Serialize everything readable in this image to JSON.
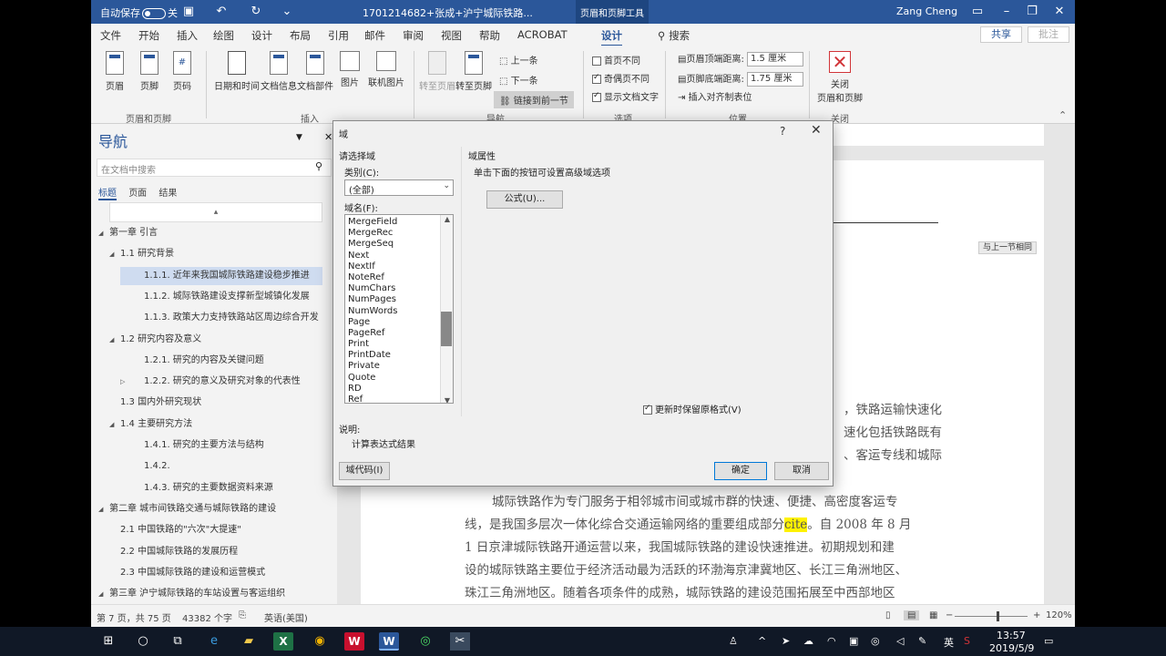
{
  "titlebar": {
    "autosave_label": "自动保存",
    "autosave_state": "关",
    "doc_title": "1701214682+张成+沪宁城际铁路...",
    "context_tab": "页眉和页脚工具",
    "user": "Zang Cheng"
  },
  "menu": {
    "items": [
      "文件",
      "开始",
      "插入",
      "绘图",
      "设计",
      "布局",
      "引用",
      "邮件",
      "审阅",
      "视图",
      "帮助",
      "ACROBAT",
      "设计"
    ],
    "search": "搜索",
    "share": "共享",
    "comment": "批注"
  },
  "ribbon": {
    "header_footer": [
      "页眉",
      "页脚",
      "页码"
    ],
    "insert": [
      "日期和时间",
      "文档信息",
      "文档部件",
      "图片",
      "联机图片"
    ],
    "navigate": [
      "转至页眉",
      "转至页脚"
    ],
    "nav_small": [
      "上一条",
      "下一条",
      "链接到前一节"
    ],
    "options": [
      "首页不同",
      "奇偶页不同",
      "显示文档文字"
    ],
    "position": {
      "header_top_label": "页眉顶端距离:",
      "header_top_value": "1.5 厘米",
      "footer_bottom_label": "页脚底端距离:",
      "footer_bottom_value": "1.75 厘米",
      "align_tab": "插入对齐制表位"
    },
    "close": "关闭\n页眉和页脚",
    "close_l1": "关闭",
    "close_l2": "页眉和页脚",
    "groups": [
      "页眉和页脚",
      "插入",
      "导航",
      "选项",
      "位置",
      "关闭"
    ]
  },
  "nav": {
    "title": "导航",
    "search_placeholder": "在文档中搜索",
    "tabs": [
      "标题",
      "页面",
      "结果"
    ],
    "items": [
      {
        "text": "第一章  引言",
        "level": 0,
        "arrow": "◢"
      },
      {
        "text": "1.1 研究背景",
        "level": 1,
        "arrow": "◢"
      },
      {
        "text": "1.1.1. 近年来我国城际铁路建设稳步推进",
        "level": 2,
        "arrow": "",
        "selected": true
      },
      {
        "text": "1.1.2. 城际铁路建设支撑新型城镇化发展",
        "level": 2,
        "arrow": ""
      },
      {
        "text": "1.1.3. 政策大力支持铁路站区周边综合开发",
        "level": 2,
        "arrow": ""
      },
      {
        "text": "1.2 研究内容及意义",
        "level": 1,
        "arrow": "◢"
      },
      {
        "text": "1.2.1. 研究的内容及关键问题",
        "level": 2,
        "arrow": ""
      },
      {
        "text": "1.2.2. 研究的意义及研究对象的代表性",
        "level": 2,
        "arrow": "▷"
      },
      {
        "text": "1.3 国内外研究现状",
        "level": 1,
        "arrow": ""
      },
      {
        "text": "1.4 主要研究方法",
        "level": 1,
        "arrow": "◢"
      },
      {
        "text": "1.4.1. 研究的主要方法与结构",
        "level": 2,
        "arrow": ""
      },
      {
        "text": "1.4.2.",
        "level": 2,
        "arrow": ""
      },
      {
        "text": "1.4.3. 研究的主要数据资料来源",
        "level": 2,
        "arrow": ""
      },
      {
        "text": "第二章  城市间铁路交通与城际铁路的建设",
        "level": 0,
        "arrow": "◢"
      },
      {
        "text": "2.1 中国铁路的\"六次\"大提速\"",
        "level": 1,
        "arrow": ""
      },
      {
        "text": "2.2 中国城际铁路的发展历程",
        "level": 1,
        "arrow": ""
      },
      {
        "text": "2.3 中国城际铁路的建设和运营模式",
        "level": 1,
        "arrow": ""
      },
      {
        "text": "第三章  沪宁城际铁路的车站设置与客运组织",
        "level": 0,
        "arrow": "◢"
      }
    ]
  },
  "document": {
    "header_tag": "与上一节相同",
    "right_lines": [
      "，铁路运输快速化",
      "速化包括铁路既有",
      "、客运专线和城际"
    ],
    "para_lines": [
      "城际铁路作为专门服务于相邻城市间或城市群的快速、便捷、高密度客运专",
      "线，是我国多层次一体化综合交通运输网络的重要组成部分",
      "cite",
      "。自 2008 年 8 月",
      "1 日京津城际铁路开通运营以来，我国城际铁路的建设快速推进。初期规划和建",
      "设的城际铁路主要位于经济活动最为活跃的环渤海京津冀地区、长江三角洲地区、",
      "珠江三角洲地区。随着各项条件的成熟，城际铁路的建设范围拓展至中西部地区"
    ]
  },
  "dialog": {
    "title": "域",
    "help": "?",
    "choose_label": "请选择域",
    "category_label": "类别(C):",
    "category_value": "(全部)",
    "fieldname_label": "域名(F):",
    "fields": [
      "MergeField",
      "MergeRec",
      "MergeSeq",
      "Next",
      "NextIf",
      "NoteRef",
      "NumChars",
      "NumPages",
      "NumWords",
      "Page",
      "PageRef",
      "Print",
      "PrintDate",
      "Private",
      "Quote",
      "RD",
      "Ref"
    ],
    "properties_label": "域属性",
    "properties_hint": "单击下面的按钮可设置高级域选项",
    "formula_button": "公式(U)...",
    "preserve_format": "更新时保留原格式(V)",
    "description_label": "说明:",
    "description_text": "计算表达式结果",
    "field_codes_button": "域代码(I)",
    "ok_button": "确定",
    "cancel_button": "取消"
  },
  "status": {
    "page": "第 7 页，共 75 页",
    "words": "43382 个字",
    "language": "英语(美国)",
    "zoom": "120%"
  },
  "taskbar": {
    "time": "13:57",
    "date": "2019/5/9",
    "ime": "英"
  }
}
